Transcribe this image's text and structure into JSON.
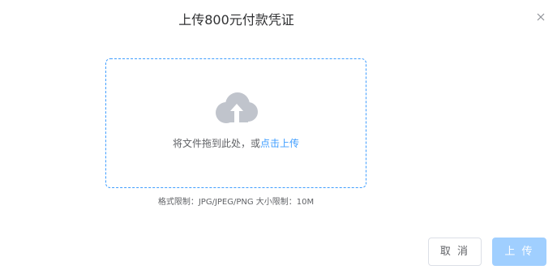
{
  "dialog": {
    "title": "上传800元付款凭证"
  },
  "upload": {
    "drop_text": "将文件拖到此处，或",
    "click_link": "点击上传",
    "hint": "格式限制：JPG/JPEG/PNG 大小限制：10M"
  },
  "buttons": {
    "cancel": "取 消",
    "upload": "上 传"
  },
  "icons": {
    "close": "close-icon",
    "upload": "cloud-upload-icon"
  },
  "colors": {
    "accent": "#409eff",
    "disabled_accent": "#a0cfff",
    "icon_gray": "#c0c4cc",
    "text": "#606266",
    "title": "#303133"
  }
}
